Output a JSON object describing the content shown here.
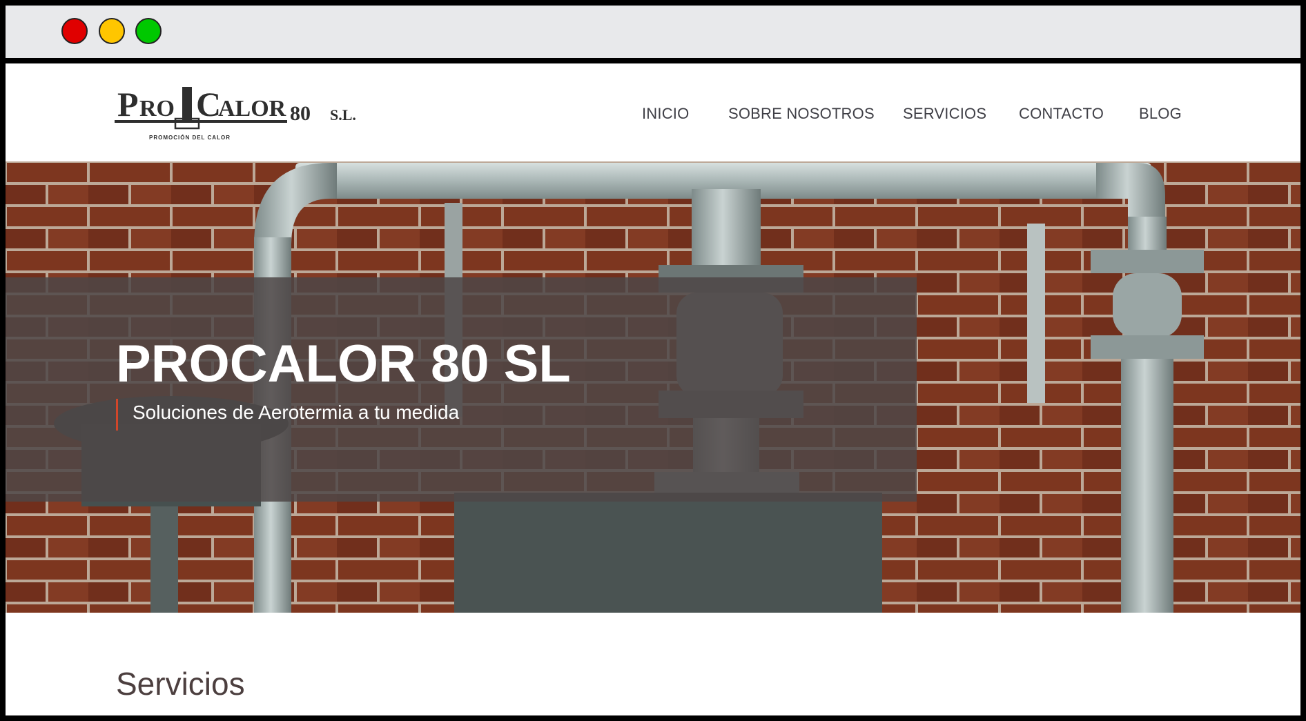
{
  "window": {
    "controls": [
      "close-dot",
      "minimize-dot",
      "maximize-dot"
    ]
  },
  "header": {
    "logo": {
      "main": "PRO CALOR",
      "number": "80",
      "suffix": "S.L.",
      "tagline": "PROMOCIÓN DEL CALOR"
    },
    "nav": [
      {
        "label": "INICIO"
      },
      {
        "label": "SOBRE NOSOTROS"
      },
      {
        "label": "SERVICIOS"
      },
      {
        "label": "CONTACTO"
      },
      {
        "label": "BLOG"
      }
    ]
  },
  "hero": {
    "title": "PROCALOR 80 SL",
    "subtitle": "Soluciones de Aerotermia a tu medida"
  },
  "section": {
    "title": "Servicios"
  },
  "colors": {
    "accent": "#d0462a",
    "overlay": "#4e4646",
    "nav_text": "#3f3f46",
    "brick": "#8a3a22"
  }
}
